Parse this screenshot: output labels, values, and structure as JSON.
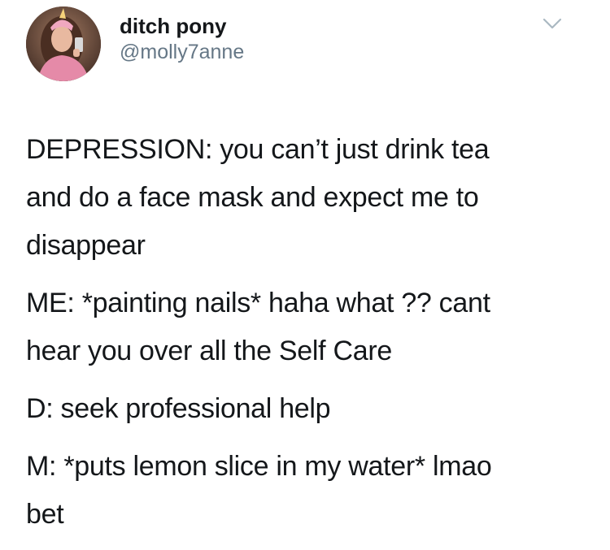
{
  "tweet": {
    "author": {
      "display_name": "ditch pony",
      "handle": "@molly7anne",
      "avatar_icon": "profile-avatar"
    },
    "menu_icon": "chevron-down-icon",
    "paragraphs": [
      {
        "lines": [
          "DEPRESSION: you can’t just drink tea",
          "and do a face mask and expect me to",
          "disappear"
        ]
      },
      {
        "lines": [
          "ME: *painting nails* haha what ?? cant",
          "hear you over all the Self Care"
        ]
      },
      {
        "lines": [
          "D: seek professional help"
        ]
      },
      {
        "lines": [
          "M: *puts lemon slice in my water* lmao",
          "bet"
        ]
      }
    ]
  },
  "colors": {
    "text": "#14171a",
    "secondary": "#657786",
    "caret": "#aab8c2",
    "background": "#ffffff"
  }
}
